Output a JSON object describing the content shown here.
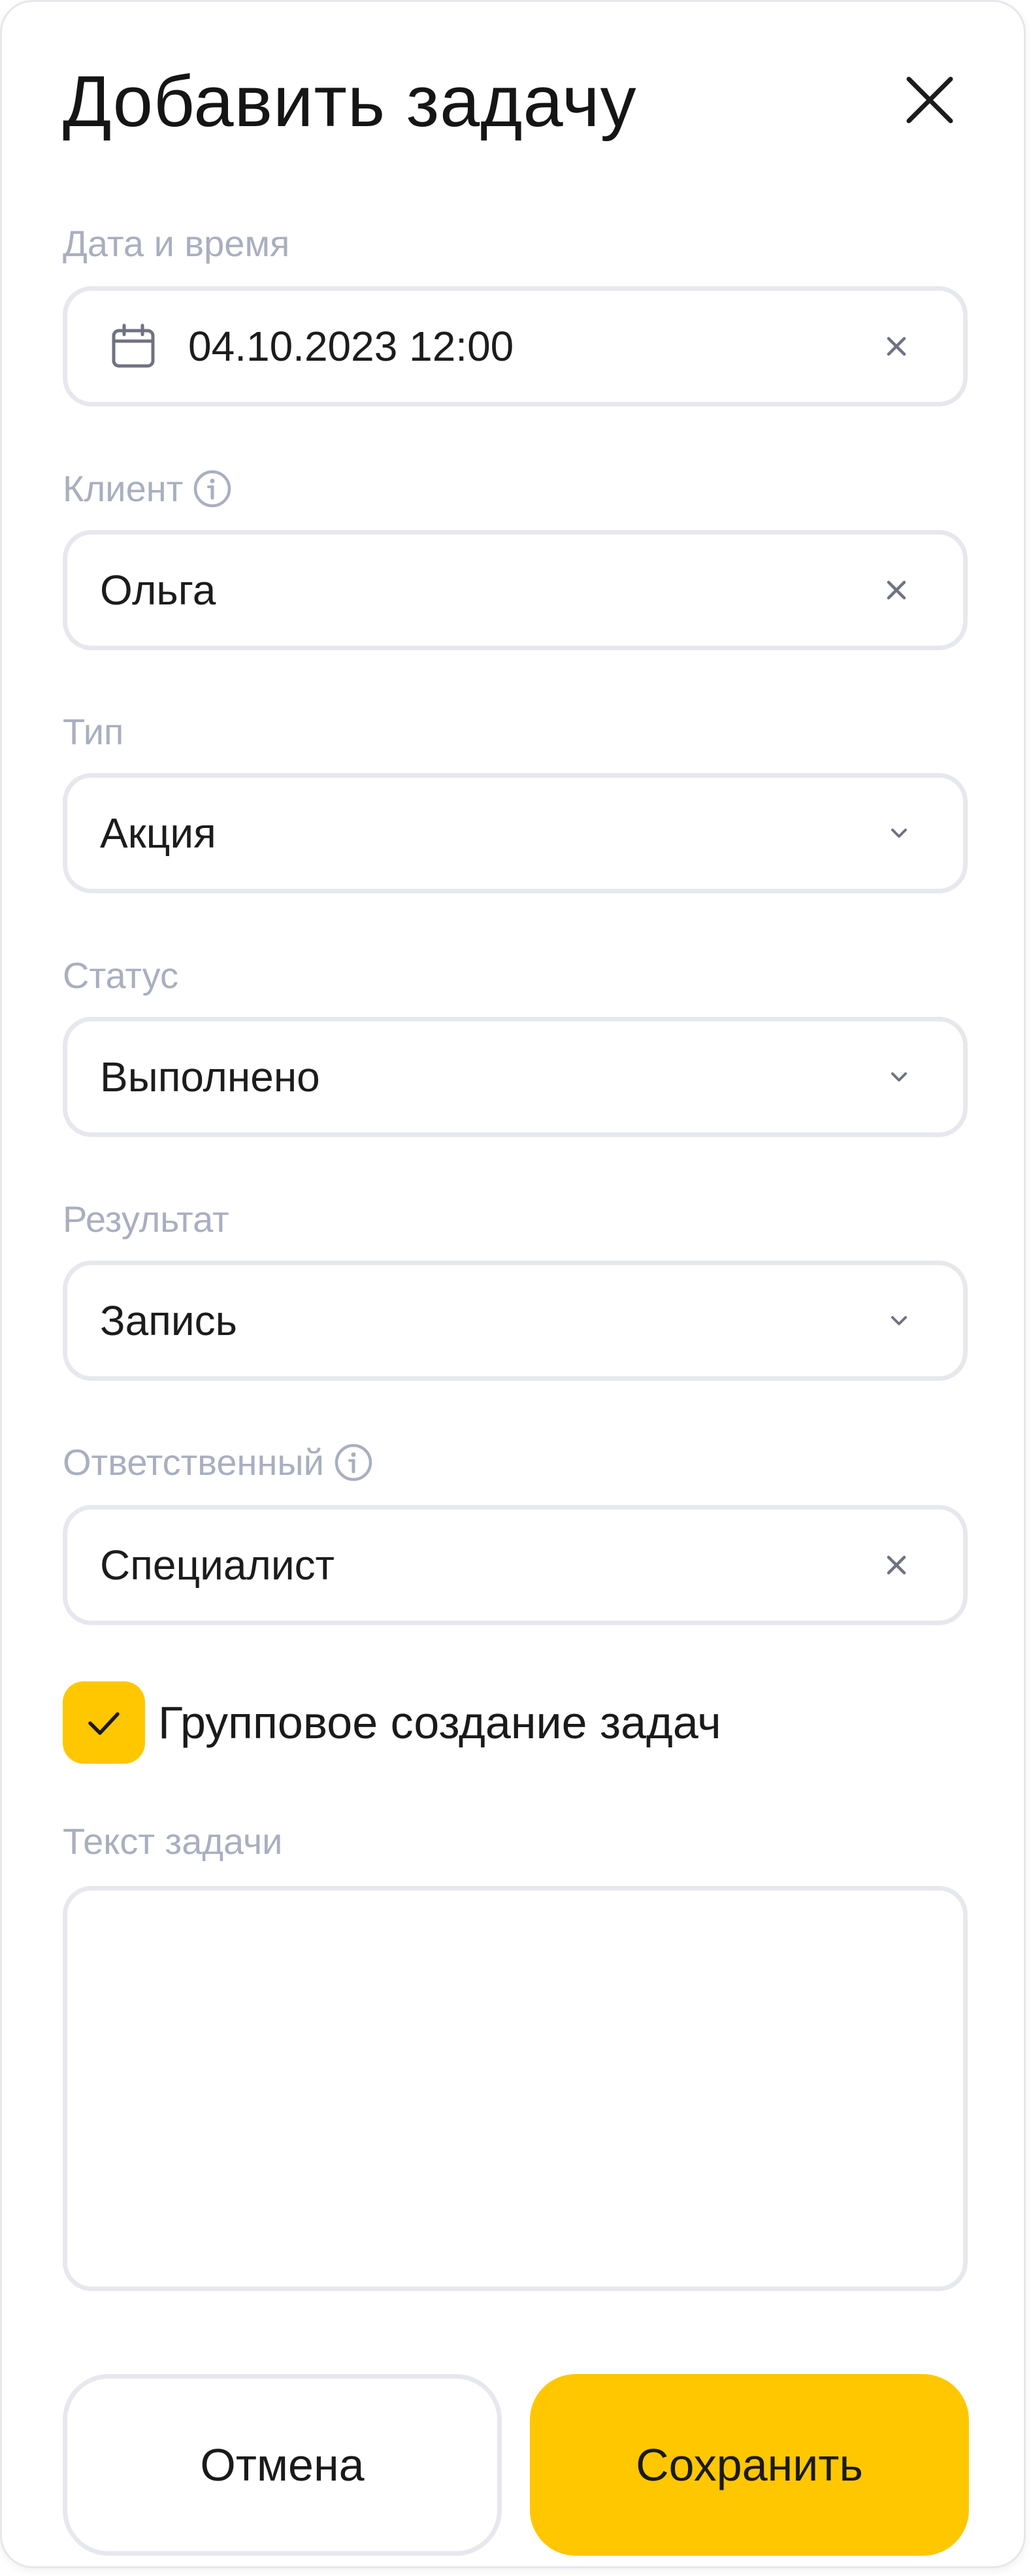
{
  "dialog": {
    "title": "Добавить задачу"
  },
  "fields": {
    "datetime": {
      "label": "Дата и время",
      "value": "04.10.2023 12:00"
    },
    "client": {
      "label": "Клиент",
      "value": "Ольга"
    },
    "type": {
      "label": "Тип",
      "value": "Акция"
    },
    "status": {
      "label": "Статус",
      "value": "Выполнено"
    },
    "result": {
      "label": "Результат",
      "value": "Запись"
    },
    "responsible": {
      "label": "Ответственный",
      "value": "Специалист"
    },
    "group_create": {
      "label": "Групповое создание задач",
      "checked": true
    },
    "task_text": {
      "label": "Текст задачи",
      "value": ""
    }
  },
  "buttons": {
    "cancel": "Отмена",
    "save": "Сохранить"
  },
  "icons": {
    "close": "close-icon",
    "calendar": "calendar-icon",
    "clear": "clear-icon",
    "chevron": "chevron-down-icon",
    "info": "info-icon",
    "check": "checkmark-icon"
  },
  "colors": {
    "accent": "#FFC700",
    "label": "#A9AFBF",
    "border": "#E7E8EE"
  }
}
